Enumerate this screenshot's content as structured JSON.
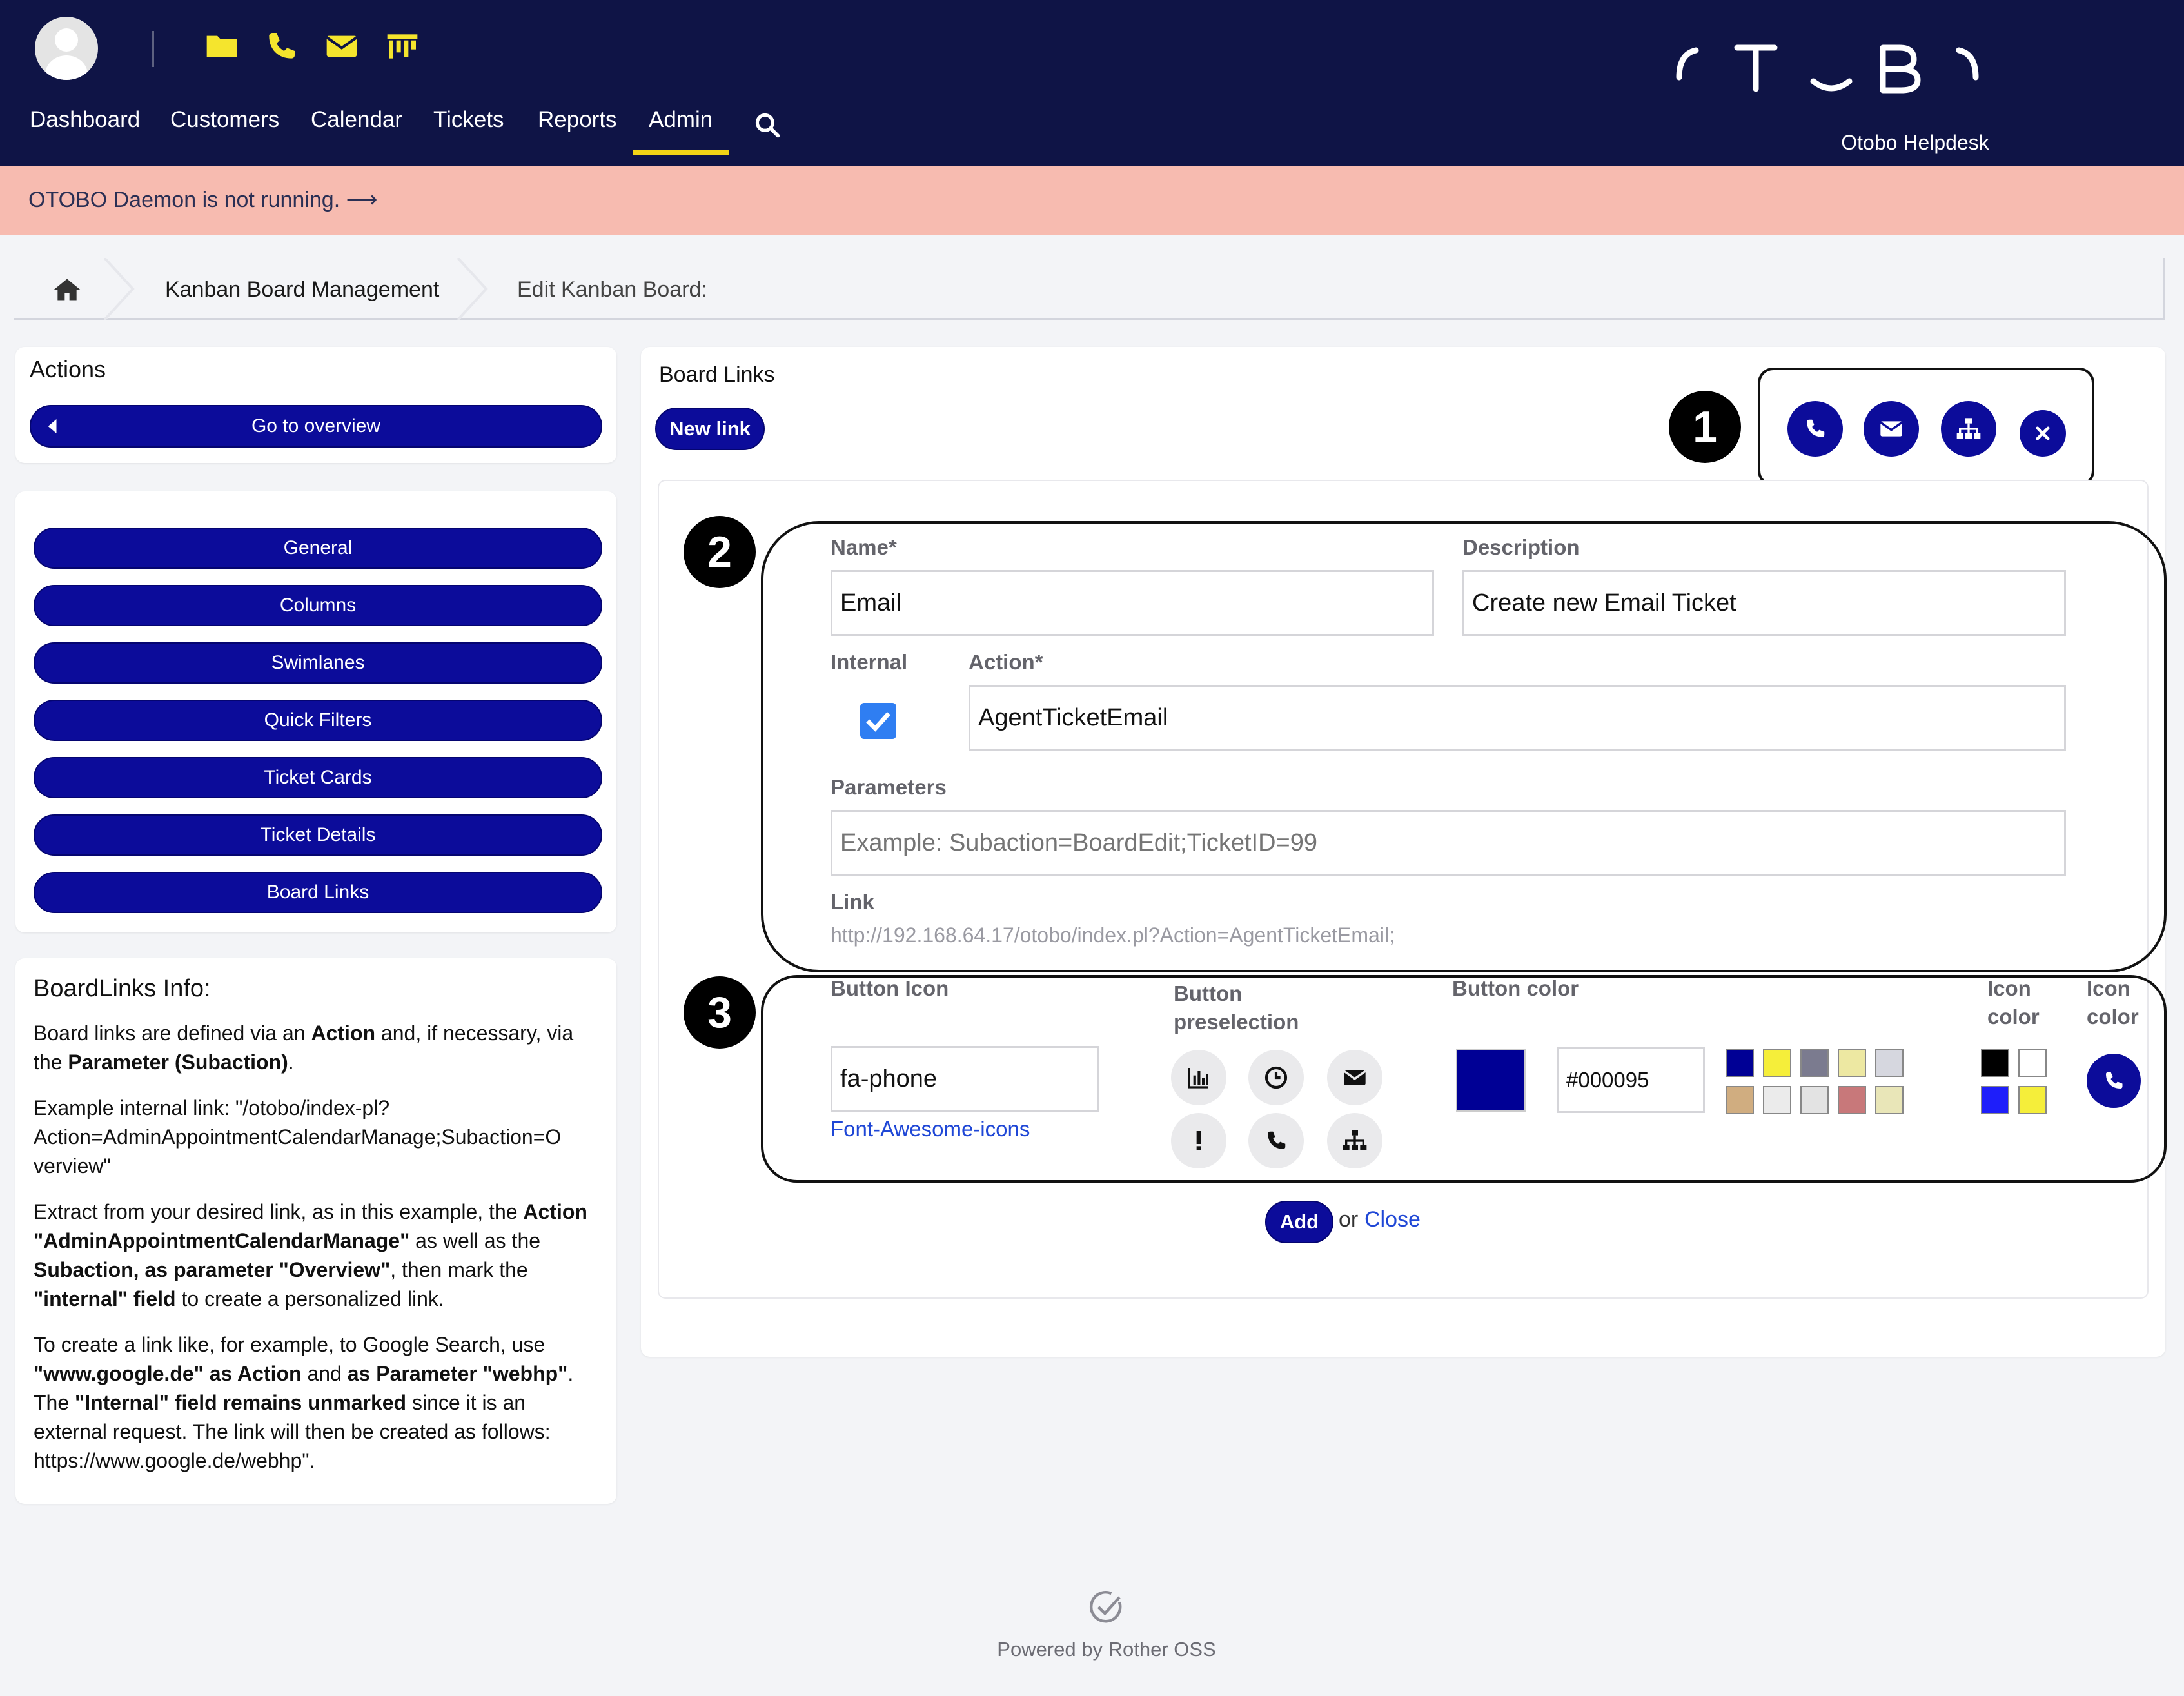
{
  "header": {
    "quick_icons": [
      "folder-icon",
      "phone-icon",
      "envelope-icon",
      "kanban-icon"
    ],
    "nav": [
      "Dashboard",
      "Customers",
      "Calendar",
      "Tickets",
      "Reports",
      "Admin"
    ],
    "active_nav": "Admin",
    "logo_subtitle": "Otobo Helpdesk",
    "accent_color": "#f2d416",
    "bg_color": "#0f1446"
  },
  "banner": {
    "text": "OTOBO Daemon is not running. ⟶"
  },
  "breadcrumb": {
    "items": [
      "Kanban Board Management",
      "Edit Kanban Board:"
    ]
  },
  "sidebar": {
    "actions_title": "Actions",
    "go_overview": "Go to overview",
    "menu": [
      "General",
      "Columns",
      "Swimlanes",
      "Quick Filters",
      "Ticket Cards",
      "Ticket Details",
      "Board Links"
    ],
    "info_title": "BoardLinks Info:"
  },
  "main": {
    "title": "Board Links",
    "new_link": "New link",
    "callouts": [
      "1",
      "2",
      "3"
    ],
    "form": {
      "name_label": "Name*",
      "name_value": "Email",
      "desc_label": "Description",
      "desc_value": "Create new Email Ticket",
      "internal_label": "Internal",
      "internal_checked": true,
      "action_label": "Action*",
      "action_value": "AgentTicketEmail",
      "params_label": "Parameters",
      "params_placeholder": "Example: Subaction=BoardEdit;TicketID=99",
      "link_label": "Link",
      "link_value": "http://192.168.64.17/otobo/index.pl?Action=AgentTicketEmail;",
      "button_icon_label": "Button Icon",
      "button_icon_value": "fa-phone",
      "font_awesome_link": "Font-Awesome-icons",
      "preselection_label_1": "Button",
      "preselection_label_2": "preselection",
      "button_color_label": "Button color",
      "button_color_value": "#000095",
      "icon_color_label_1a": "Icon",
      "icon_color_label_1b": "color",
      "icon_color_label_2a": "Icon",
      "icon_color_label_2b": "color",
      "add": "Add",
      "or": "or",
      "close": "Close"
    },
    "swatches": [
      "#000095",
      "#f5ee3a",
      "#7b7b8f",
      "#ede8a2",
      "#d6d7df",
      "#d0ad80",
      "#ebebeb",
      "#e3e3e3",
      "#c8787a",
      "#e9e6b8"
    ],
    "icon_swatches": [
      "#000000",
      "#ffffff",
      "#1e1efa",
      "#f5ee3a"
    ]
  },
  "footer": {
    "text": "Powered by Rother OSS"
  }
}
